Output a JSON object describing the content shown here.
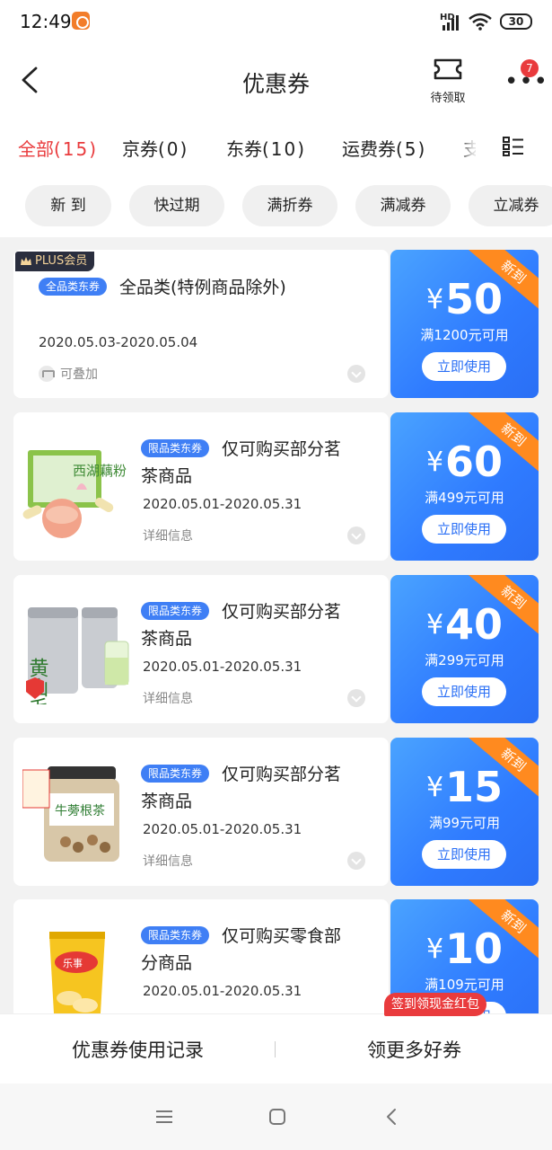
{
  "status_bar": {
    "time": "12:49",
    "network": "HD",
    "battery": "30"
  },
  "header": {
    "title": "优惠券",
    "pending_label": "待领取",
    "more_badge": "7"
  },
  "tabs": [
    {
      "label": "全部",
      "count": "(15)",
      "active": true
    },
    {
      "label": "京券",
      "count": "(0)",
      "active": false
    },
    {
      "label": "东券",
      "count": "(10)",
      "active": false
    },
    {
      "label": "运费券",
      "count": "(5)",
      "active": false
    },
    {
      "label": "支",
      "count": "",
      "active": false
    }
  ],
  "filters": [
    "新 到",
    "快过期",
    "满折券",
    "满减券",
    "立减券"
  ],
  "coupons": [
    {
      "plus_tag": "PLUS会员",
      "type_tag": "全品类东券",
      "title": "全品类(特例商品除外)",
      "date": "2020.05.03-2020.05.04",
      "footer": "可叠加",
      "ribbon": "新到",
      "currency": "¥",
      "amount": "50",
      "condition": "满1200元可用",
      "button": "立即使用"
    },
    {
      "type_tag": "限品类东券",
      "title_line1": "仅可购买部分茗",
      "title_line2": "茶商品",
      "date": "2020.05.01-2020.05.31",
      "footer": "详细信息",
      "ribbon": "新到",
      "currency": "¥",
      "amount": "60",
      "condition": "满499元可用",
      "button": "立即使用",
      "product_text": "西湖藕粉"
    },
    {
      "type_tag": "限品类东券",
      "title_line1": "仅可购买部分茗",
      "title_line2": "茶商品",
      "date": "2020.05.01-2020.05.31",
      "footer": "详细信息",
      "ribbon": "新到",
      "currency": "¥",
      "amount": "40",
      "condition": "满299元可用",
      "button": "立即使用",
      "product_text": "黄山毛峰"
    },
    {
      "type_tag": "限品类东券",
      "title_line1": "仅可购买部分茗",
      "title_line2": "茶商品",
      "date": "2020.05.01-2020.05.31",
      "footer": "详细信息",
      "ribbon": "新到",
      "currency": "¥",
      "amount": "15",
      "condition": "满99元可用",
      "button": "立即使用",
      "product_text": "牛蒡根茶"
    },
    {
      "type_tag": "限品类东券",
      "title_line1": "仅可购买零食部",
      "title_line2": "分商品",
      "date": "2020.05.01-2020.05.31",
      "footer": "",
      "ribbon": "新到",
      "currency": "¥",
      "amount": "10",
      "condition": "满109元可用",
      "button": "立即使用",
      "product_text": "乐事"
    }
  ],
  "bottom_bar": {
    "record": "优惠券使用记录",
    "get_more": "领更多好券",
    "promo": "签到领现金红包"
  },
  "colors": {
    "accent_red": "#e93b3d",
    "coupon_blue": "#2f7bff",
    "ribbon_orange": "#ff8a1f",
    "tag_blue": "#3f7ff5"
  }
}
